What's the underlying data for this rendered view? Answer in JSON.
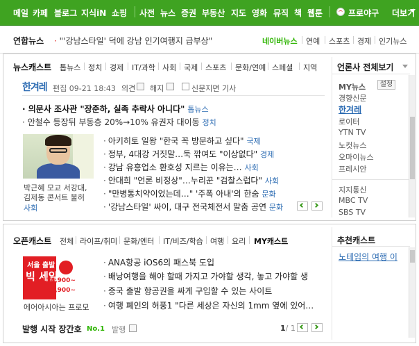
{
  "topnav": {
    "items": [
      "메일",
      "카페",
      "블로그",
      "지식iN",
      "쇼핑",
      "사전",
      "뉴스",
      "증권",
      "부동산",
      "지도",
      "영화",
      "뮤직",
      "책",
      "웹툰",
      "프로야구",
      "더보기"
    ]
  },
  "ticker": {
    "source": "연합뉴스",
    "headline": "'강남스타일' 덕에 강남 인기여행지 급부상",
    "links": [
      "네이버뉴스",
      "연예",
      "스포츠",
      "경제",
      "인기뉴스"
    ]
  },
  "newscast": {
    "tabs": [
      "뉴스캐스트",
      "톱뉴스",
      "정치",
      "경제",
      "IT/과학",
      "사회",
      "국제",
      "스포츠",
      "문화/연예",
      "스페셜",
      "지역"
    ],
    "press_name": "한겨레",
    "edit_time": "편집 09-21 18:43",
    "opinion": "의견",
    "unsubscribe": "해지",
    "paper_article": "신문지면 기사",
    "lead1": "의문사 조사관 \"장준하, 실족 추락사 아니다\"",
    "lead1_cat": "톱뉴스",
    "lead2": "안철수 등장뒤 부동층 20%→10% 유권자 대이동",
    "lead2_cat": "정치",
    "photo_caption1": "박근혜 모교 서강대,",
    "photo_caption2": "김제동 콘서트 불허",
    "photo_caption3": "사회",
    "list": [
      {
        "text": "아키히토 일왕 \"한국 꼭 방문하고 싶다\"",
        "cat": "국제"
      },
      {
        "text": "정부, 4대강 거짓말…둑 깎여도 \"이상없다\"",
        "cat": "경제"
      },
      {
        "text": "강남 유흥업소 환호성 지르는 이유는…",
        "cat": "사회"
      },
      {
        "text": "안대희 \"언론 비정상\"…누리꾼 \"검찰스럽다\"",
        "cat": "사회"
      },
      {
        "text": "\"만병통치약이었는데…\" '주폭 아내'의 한숨",
        "cat": "문화"
      },
      {
        "text": "'강남스타일' 싸이, 대구 전국체전서 말춤 공연",
        "cat": "문화"
      }
    ]
  },
  "press_sidebar": {
    "title": "언론사 전체보기",
    "my_label": "MY뉴스",
    "settings": "설정",
    "items": [
      "경향신문",
      "한겨레",
      "로이터",
      "YTN TV",
      "노컷뉴스",
      "오마이뉴스",
      "프레시안"
    ],
    "items2": [
      "지지통신",
      "MBC TV",
      "SBS TV"
    ]
  },
  "opencast": {
    "tabs": [
      "오픈캐스트",
      "전체",
      "라이프/취미",
      "문화/엔터",
      "IT/비즈/학습",
      "여행",
      "요리",
      "MY캐스트"
    ],
    "list": [
      "ANA항공 iOS6의 패스북 도입",
      "배낭여행을 해야 할때 가지고 가야할 생각, 놓고 가야할 생",
      "중국 출발 항공권을 싸게 구입할 수 있는 사이트",
      "여행 폐인의 허풍1 \"다른 세상은 자신의 1mm 옆에 있어…"
    ],
    "promo_caption": "에어아시아는 프로모",
    "promo_line1": "서울 출발",
    "promo_line2": "빅 세일!",
    "promo_price1": "134,900~",
    "promo_price2": "180,900~",
    "footer_title": "발행 시작 장간호",
    "footer_badge": "No.1",
    "footer_publish": "발행",
    "page_current": "1",
    "page_total": "/ 1"
  },
  "recommend": {
    "title": "추천캐스트",
    "item": "노테임의 여행 이"
  }
}
